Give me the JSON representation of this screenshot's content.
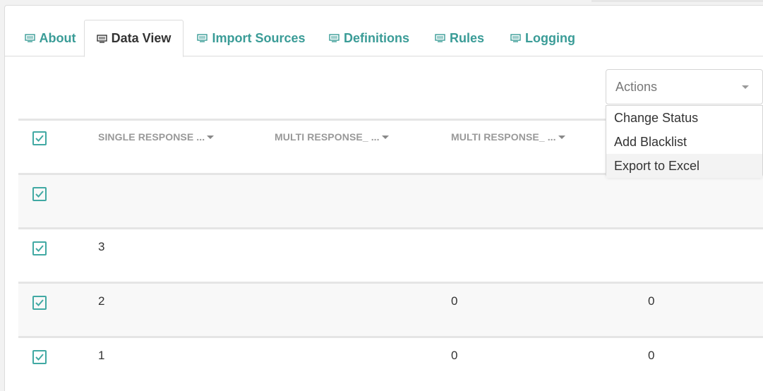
{
  "tabs": [
    {
      "label": "About",
      "icon": "monitor-icon",
      "active": false
    },
    {
      "label": "Data View",
      "icon": "monitor-icon",
      "active": true
    },
    {
      "label": "Import Sources",
      "icon": "monitor-icon",
      "active": false
    },
    {
      "label": "Definitions",
      "icon": "monitor-icon",
      "active": false
    },
    {
      "label": "Rules",
      "icon": "monitor-icon",
      "active": false
    },
    {
      "label": "Logging",
      "icon": "monitor-icon",
      "active": false
    }
  ],
  "actions": {
    "placeholder": "Actions",
    "options": [
      "Change Status",
      "Add Blacklist",
      "Export to Excel"
    ],
    "highlighted": "Export to Excel"
  },
  "table": {
    "columns": [
      "SINGLE RESPONSE ...",
      "MULTI RESPONSE_ ...",
      "MULTI RESPONSE_ ..."
    ],
    "rows": [
      {
        "checked": true,
        "cells": [
          "",
          "",
          "",
          ""
        ]
      },
      {
        "checked": true,
        "cells": [
          "3",
          "",
          "",
          ""
        ]
      },
      {
        "checked": true,
        "cells": [
          "2",
          "",
          "0",
          "0"
        ]
      },
      {
        "checked": true,
        "cells": [
          "1",
          "",
          "0",
          "0"
        ]
      }
    ]
  },
  "colors": {
    "accent": "#3a9c97",
    "checkbox": "#41a9a3",
    "header_text": "#999999",
    "row_shade": "#f8f8f8"
  }
}
